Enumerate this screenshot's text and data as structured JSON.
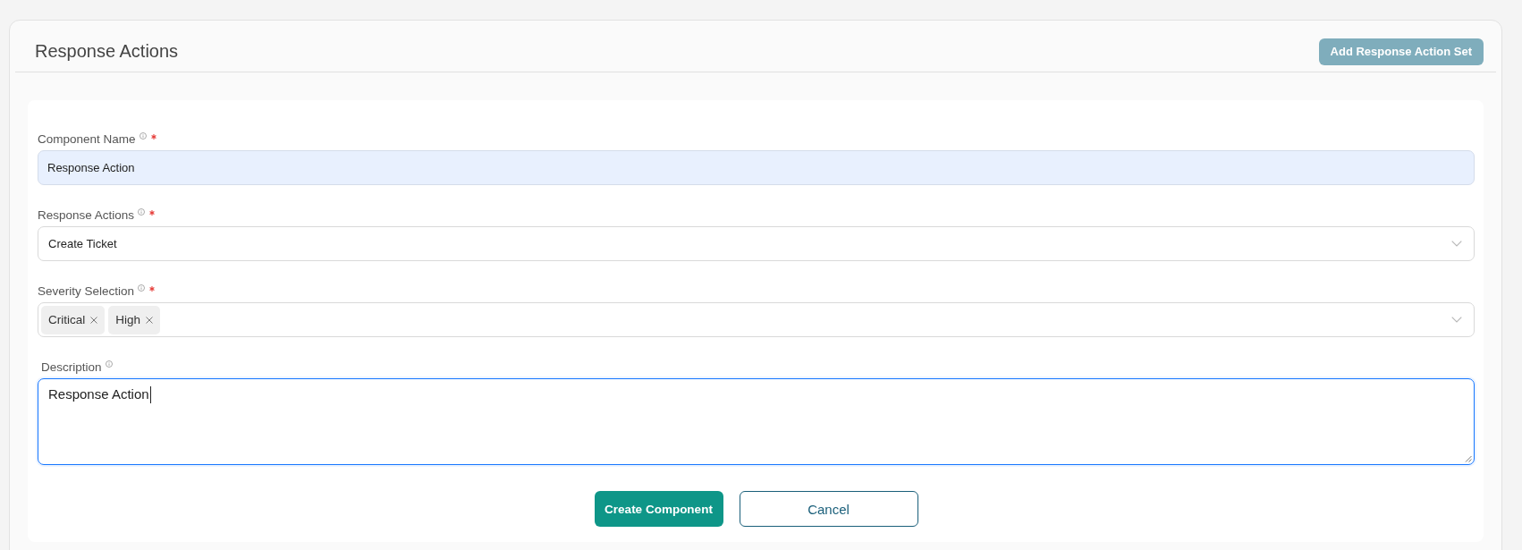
{
  "header": {
    "title": "Response Actions",
    "action_button": "Add Response Action Set"
  },
  "form": {
    "fields": [
      {
        "kind": "text",
        "label": "Component Name",
        "required": true,
        "value": "Response Action",
        "autofilled": true,
        "focused": false
      },
      {
        "kind": "select",
        "label": "Response Actions",
        "required": true,
        "value": "Create Ticket",
        "autofilled": false,
        "focused": false
      },
      {
        "kind": "multiselect",
        "label": "Severity Selection",
        "required": true,
        "tags": [
          "Critical",
          "High"
        ],
        "autofilled": false,
        "focused": false
      },
      {
        "kind": "textarea",
        "label": "Description",
        "required": false,
        "value": "Response Action",
        "autofilled": false,
        "focused": true
      }
    ],
    "buttons": [
      {
        "kind": "primary",
        "label": "Create Component"
      },
      {
        "kind": "secondary",
        "label": "Cancel"
      }
    ]
  }
}
